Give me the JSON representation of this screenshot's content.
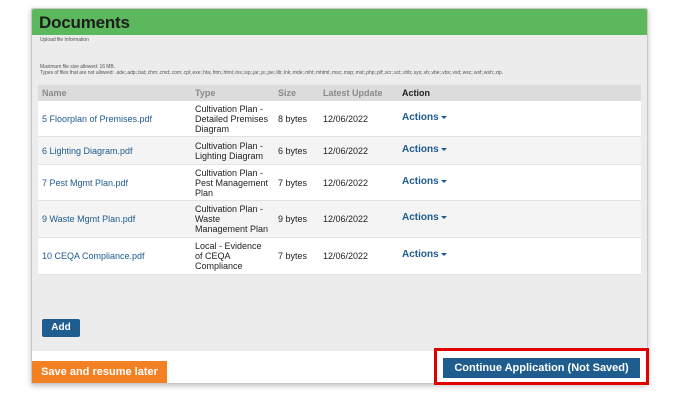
{
  "section": {
    "title": "Documents",
    "upload_info": "Upload file Information",
    "max_size": "Maximum file size allowed: 16 MB.",
    "disallowed_types": "Types of files that are not allowed: .ade;.adp;.bat;.chm;.cmd;.com;.cpl;.exe;.hta;.htm;.html;.ins;.isp;.jar;.js;.jse;.lib;.lnk;.mde;.mht;.mhtml;.msc;.msp;.mst;.php;.pif;.scr;.sct;.shb;.sys;.vb;.vbe;.vbs;.vxd;.wsc;.wsf;.wsh;.zip."
  },
  "table": {
    "headers": {
      "name": "Name",
      "type": "Type",
      "size": "Size",
      "date": "Latest Update",
      "action": "Action"
    },
    "rows": [
      {
        "name": "5 Floorplan of Premises.pdf",
        "type_lines": [
          "Cultivation Plan -",
          "Detailed Premises",
          "Diagram"
        ],
        "size": "8 bytes",
        "date": "12/06/2022",
        "action": "Actions"
      },
      {
        "name": "6 Lighting Diagram.pdf",
        "type_lines": [
          "Cultivation Plan -",
          "Lighting Diagram"
        ],
        "size": "6 bytes",
        "date": "12/06/2022",
        "action": "Actions"
      },
      {
        "name": "7 Pest Mgmt Plan.pdf",
        "type_lines": [
          "Cultivation Plan -",
          "Pest Management",
          "Plan"
        ],
        "size": "7 bytes",
        "date": "12/06/2022",
        "action": "Actions"
      },
      {
        "name": "9 Waste Mgmt Plan.pdf",
        "type_lines": [
          "Cultivation Plan -",
          "Waste",
          "Management Plan"
        ],
        "size": "9 bytes",
        "date": "12/06/2022",
        "action": "Actions"
      },
      {
        "name": "10 CEQA Compliance.pdf",
        "type_lines": [
          "Local - Evidence",
          "of CEQA",
          "Compliance"
        ],
        "size": "7 bytes",
        "date": "12/06/2022",
        "action": "Actions"
      }
    ]
  },
  "buttons": {
    "add": "Add",
    "save_resume": "Save and resume later",
    "continue": "Continue Application (Not Saved)"
  },
  "colors": {
    "header_green": "#5cb85c",
    "primary_blue": "#1f5d8e",
    "save_orange": "#f48024",
    "highlight_red": "#e00000"
  }
}
